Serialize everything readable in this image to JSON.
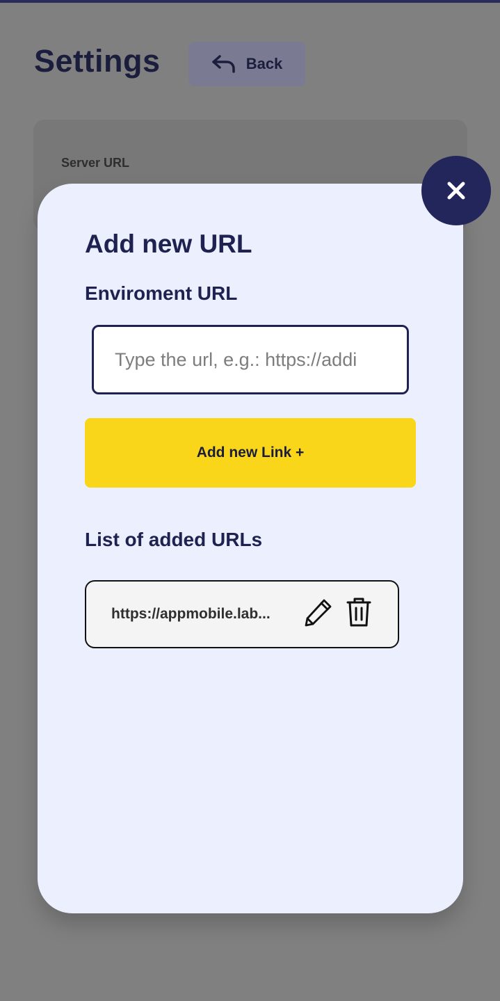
{
  "background_page": {
    "title": "Settings",
    "back_button": {
      "label": "Back",
      "icon": "back-arrow-icon"
    },
    "server_url_label": "Server URL"
  },
  "modal": {
    "close_icon": "close-icon",
    "title": "Add new URL",
    "environment_label": "Enviroment URL",
    "url_input": {
      "value": "",
      "placeholder": "Type the url, e.g.: https://addi"
    },
    "add_button_label": "Add new Link +",
    "list_title": "List of added URLs",
    "urls": [
      {
        "text": "https://appmobile.lab...",
        "edit_icon": "pencil-icon",
        "delete_icon": "trash-icon"
      }
    ]
  },
  "colors": {
    "overlay": "#808080",
    "modal_background": "#eceffe",
    "primary_navy": "#1f2150",
    "accent_yellow": "#fad61a"
  }
}
